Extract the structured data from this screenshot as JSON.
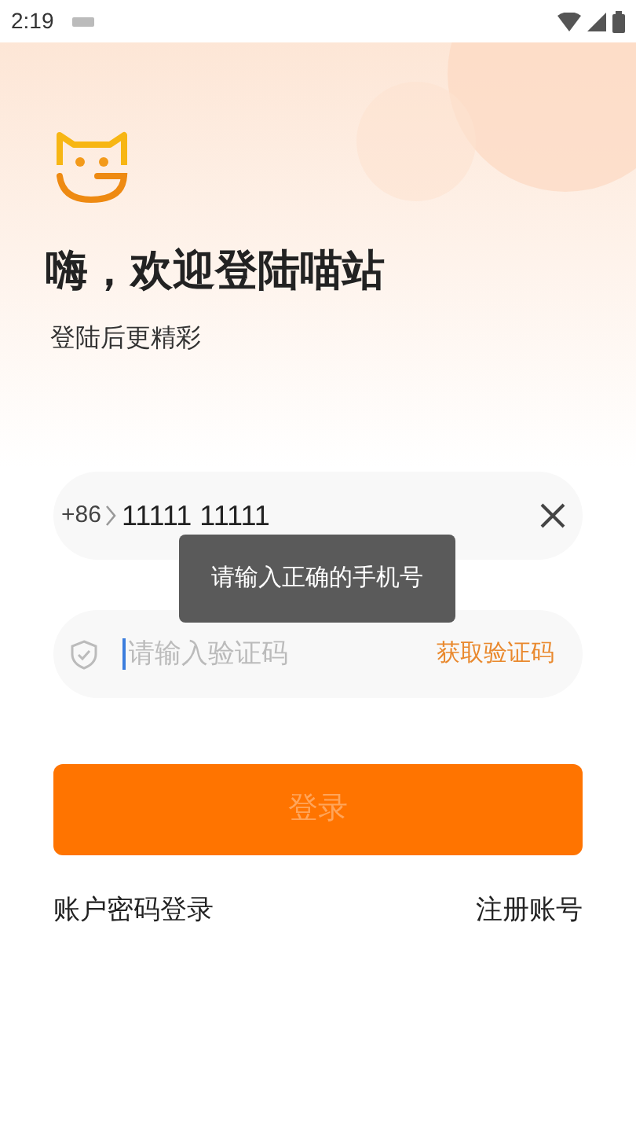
{
  "status_bar": {
    "time": "2:19"
  },
  "header": {
    "title": "嗨，欢迎登陆喵站",
    "subtitle": "登陆后更精彩"
  },
  "phone_field": {
    "country_code": "+86",
    "value": "11111 11111"
  },
  "toast": {
    "text": "请输入正确的手机号"
  },
  "code_field": {
    "placeholder": "请输入验证码",
    "action": "获取验证码"
  },
  "login_button": {
    "label": "登录",
    "disabled": true
  },
  "links": [
    "账户密码登录",
    "注册账号"
  ]
}
